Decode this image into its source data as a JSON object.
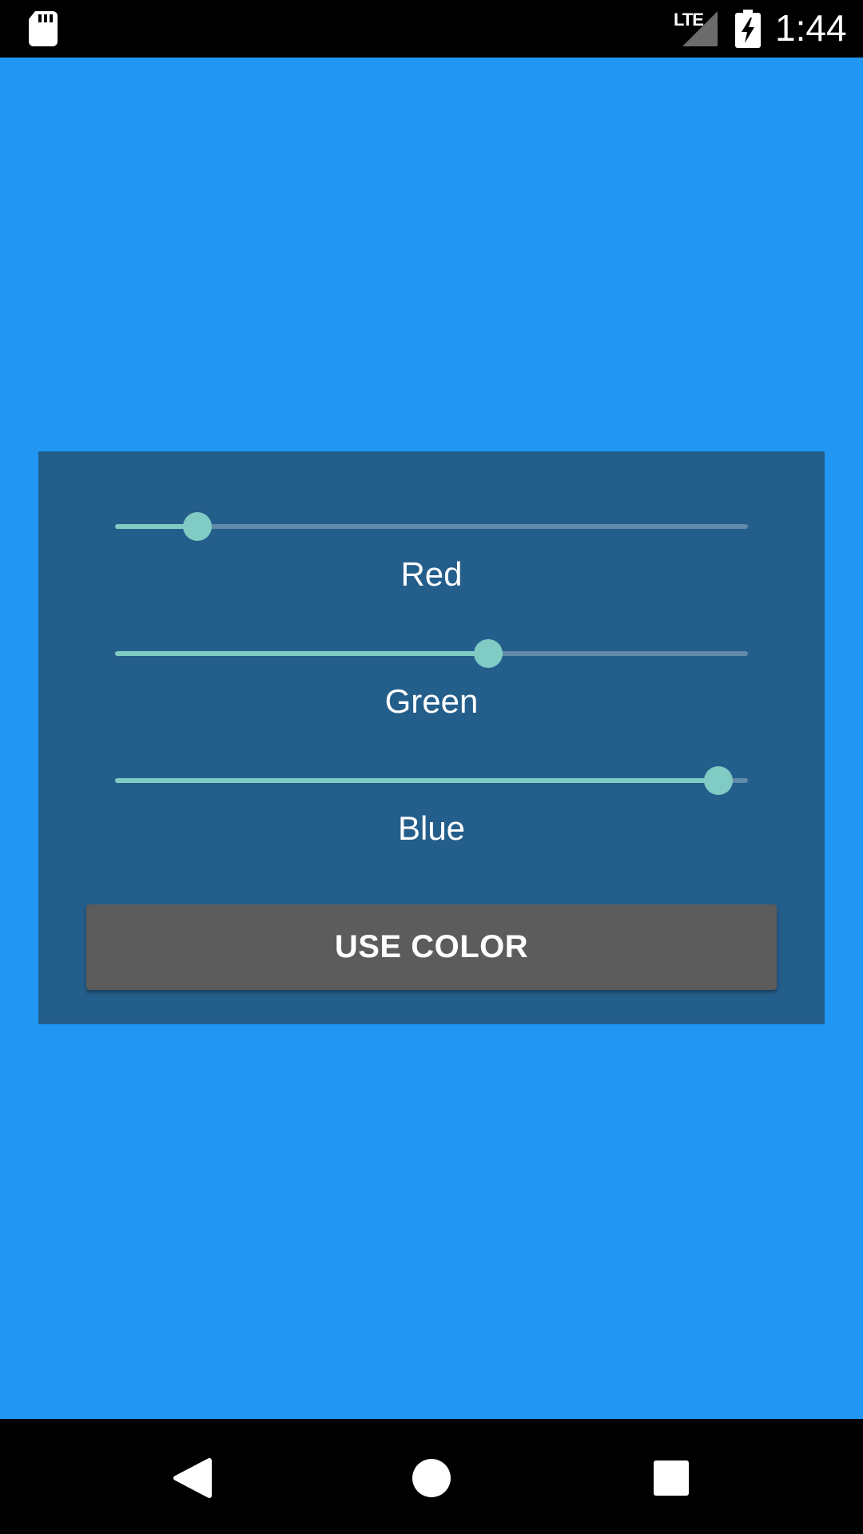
{
  "status_bar": {
    "time": "1:44",
    "network": "LTE",
    "icons": [
      "sd-card-icon",
      "signal-icon",
      "battery-charging-icon"
    ]
  },
  "colors": {
    "background": "#2196F3",
    "panel": "#245E8B",
    "slider_accent": "#80CBC4",
    "button": "#5C5C5C"
  },
  "sliders": [
    {
      "label": "Red",
      "value": 0.13
    },
    {
      "label": "Green",
      "value": 0.59
    },
    {
      "label": "Blue",
      "value": 0.953
    }
  ],
  "button": {
    "label": "USE COLOR"
  },
  "nav_bar": {
    "icons": [
      "back-icon",
      "home-icon",
      "recents-icon"
    ]
  }
}
